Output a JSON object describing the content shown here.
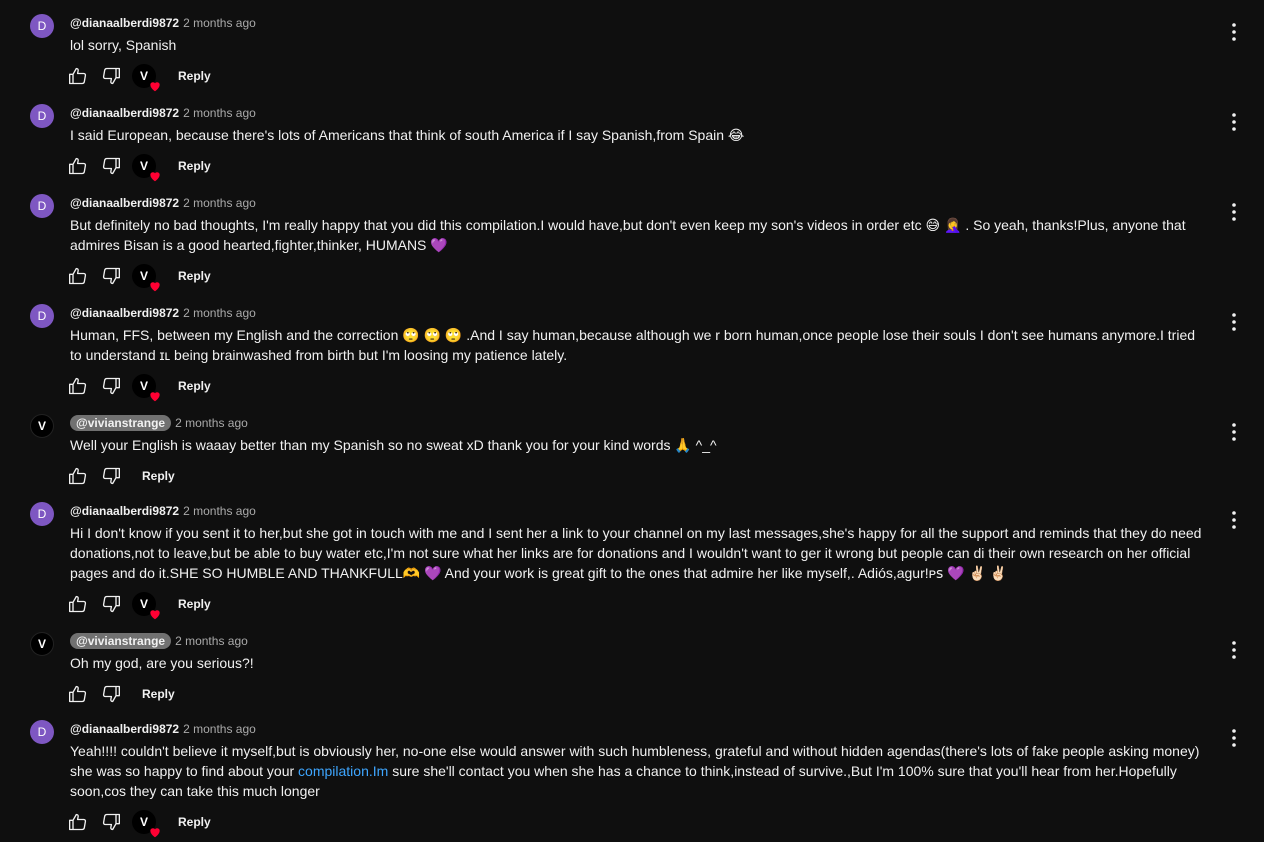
{
  "comments": [
    {
      "avatar_letter": "D",
      "author": "@dianaalberdi9872",
      "time": "2 months ago",
      "text": "lol sorry, Spanish",
      "reply": "Reply",
      "hearted": true,
      "heart_avatar_letter": "V"
    },
    {
      "avatar_letter": "D",
      "author": "@dianaalberdi9872",
      "time": "2 months ago",
      "text": "I said European, because there's lots of Americans that think of south America if I say Spanish,from Spain 😂",
      "reply": "Reply",
      "hearted": true,
      "heart_avatar_letter": "V"
    },
    {
      "avatar_letter": "D",
      "author": "@dianaalberdi9872",
      "time": "2 months ago",
      "text": "But definitely no bad thoughts, I'm really happy that you did this compilation.I would have,but don't even keep my son's videos in order etc 😅 🤦‍♀️ . So yeah, thanks!Plus, anyone that admires Bisan is a good hearted,fighter,thinker, HUMANS 💜",
      "reply": "Reply",
      "hearted": true,
      "heart_avatar_letter": "V"
    },
    {
      "avatar_letter": "D",
      "author": "@dianaalberdi9872",
      "time": "2 months ago",
      "text": "Human, FFS, between my English and the correction 🙄 🙄 🙄 .And I say human,because although we r born human,once people lose their souls I don't see humans anymore.I tried to understand ɪʟ being brainwashed from birth but I'm loosing my patience lately.",
      "reply": "Reply",
      "hearted": true,
      "heart_avatar_letter": "V"
    },
    {
      "avatar_letter": "V",
      "author": "@vivianstrange",
      "time": "2 months ago",
      "text": "Well your English is waaay better than my Spanish so no sweat xD thank you for your kind words 🙏 ^_^",
      "reply": "Reply",
      "hearted": false
    },
    {
      "avatar_letter": "D",
      "author": "@dianaalberdi9872",
      "time": "2 months ago",
      "text": "Hi I don't know if you sent it to her,but she got in touch with me and I sent her a link to your channel on my last messages,she's happy for all the support and reminds that they do need donations,not to leave,but be able to buy water etc,I'm  not sure what her links are for donations and I wouldn't want to ger it wrong but people can di their own research on her official pages and do it.SHE SO HUMBLE AND THANKFULL🫶 💜 And your work is great gift to the ones that admire her like myself,. Adiós,agur!ᴘꜱ 💜 ✌🏻 ✌🏻",
      "reply": "Reply",
      "hearted": true,
      "heart_avatar_letter": "V"
    },
    {
      "avatar_letter": "V",
      "author": "@vivianstrange",
      "time": "2 months ago",
      "text": "Oh my god, are you serious?!",
      "reply": "Reply",
      "hearted": false
    },
    {
      "avatar_letter": "D",
      "author": "@dianaalberdi9872",
      "time": "2 months ago",
      "text_before_link": "Yeah!!!! couldn't believe it myself,but is obviously her, no-one else would answer with such humbleness, grateful and without hidden agendas(there's lots of fake people asking money) she was so happy to find about your ",
      "link_text": "compilation.Im",
      "text_after_link": " sure she'll contact you when she has a chance to think,instead of survive.,But I'm 100% sure that you'll hear from her.Hopefully soon,cos they can take this much longer",
      "reply": "Reply",
      "hearted": true,
      "heart_avatar_letter": "V"
    }
  ],
  "colors": {
    "background": "#0f0f0f",
    "avatar_purple": "#7e57c2",
    "creator_badge": "#717171",
    "link": "#3ea6ff",
    "heart": "#ff0033"
  },
  "icons": [
    "like-icon",
    "dislike-icon",
    "heart-icon",
    "more-vert-icon"
  ]
}
